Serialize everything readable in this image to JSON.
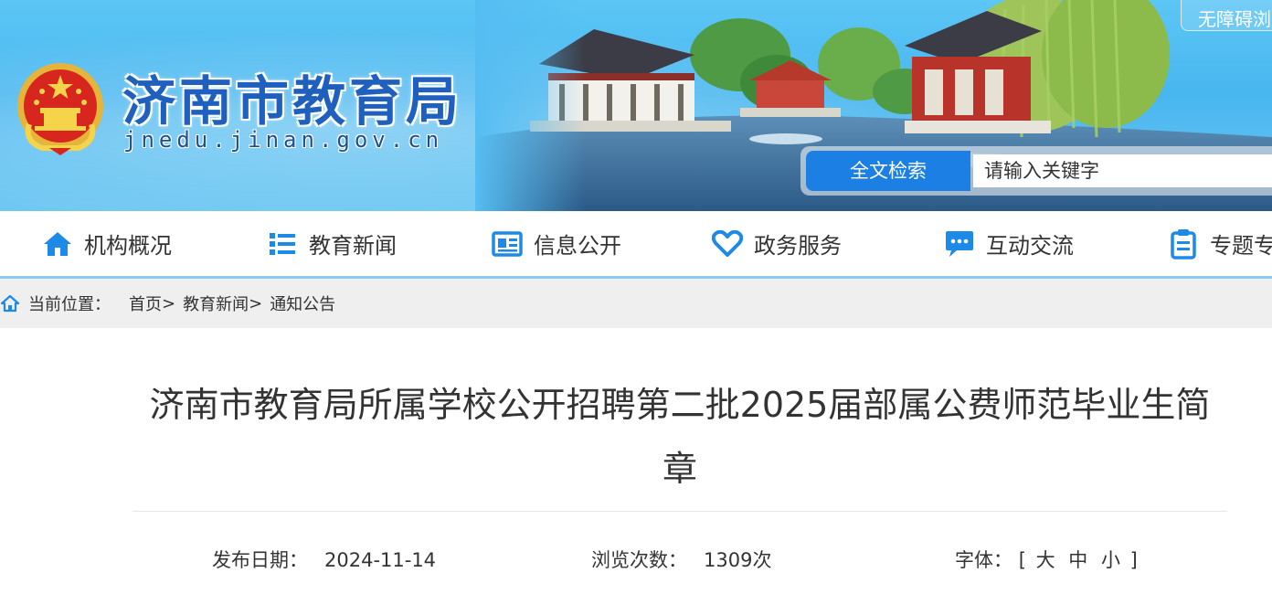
{
  "header": {
    "site_title": "济南市教育局",
    "site_domain": "jnedu.jinan.gov.cn",
    "accessibility_label": "无障碍浏览",
    "search_label": "全文检索",
    "search_placeholder": "请输入关键字"
  },
  "nav": {
    "items": [
      {
        "label": "机构概况",
        "icon": "home-icon"
      },
      {
        "label": "教育新闻",
        "icon": "list-icon"
      },
      {
        "label": "信息公开",
        "icon": "newspaper-icon"
      },
      {
        "label": "政务服务",
        "icon": "heart-icon"
      },
      {
        "label": "互动交流",
        "icon": "chat-icon"
      },
      {
        "label": "专题专栏",
        "icon": "clipboard-icon"
      }
    ]
  },
  "breadcrumb": {
    "current_label": "当前位置：",
    "items": [
      "首页",
      "教育新闻",
      "通知公告"
    ],
    "separator": ">"
  },
  "article": {
    "title_line1": "济南市教育局所属学校公开招聘第二批2025届部属公费师范毕业生简",
    "title_line2": "章",
    "publish_label": "发布日期：",
    "publish_date": "2024-11-14",
    "views_label": "浏览次数：",
    "views_value": "1309次",
    "font_label": "字体：",
    "font_open": "[",
    "font_large": "大",
    "font_medium": "中",
    "font_small": "小",
    "font_close": "]"
  },
  "colors": {
    "brand_blue": "#1f5fbd",
    "search_button": "#1c7fe3",
    "nav_icon": "#1c8ae6",
    "nav_border": "#8ccaf3"
  }
}
